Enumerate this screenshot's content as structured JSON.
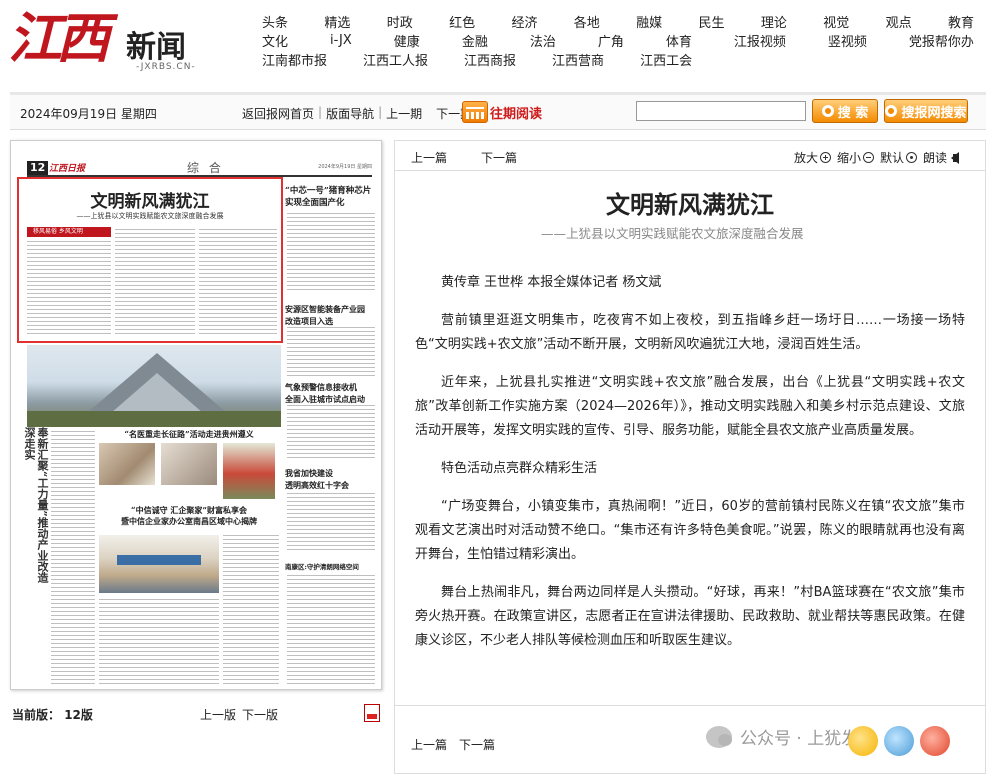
{
  "logo": {
    "script": "江西",
    "name": "新闻",
    "url": "-JXRBS.CN-"
  },
  "nav": {
    "row1": [
      "头条",
      "精选",
      "时政",
      "红色",
      "经济",
      "各地",
      "融媒",
      "民生",
      "理论",
      "视觉",
      "观点",
      "教育"
    ],
    "row2": [
      "文化",
      "i-JX",
      "健康",
      "金融",
      "法治",
      "广角",
      "体育",
      "江报视频",
      "竖视频",
      "党报帮你办"
    ],
    "row3": [
      "江南都市报",
      "江西工人报",
      "江西商报",
      "江西营商",
      "江西工会"
    ]
  },
  "toolbar": {
    "date": "2024年09月19日 星期四",
    "links": [
      "返回报网首页",
      "版面导航",
      "上一期",
      "下一期"
    ],
    "archive": "往期阅读",
    "search_value": "",
    "search_button": "搜 索",
    "site_search_button": "搜报网搜索"
  },
  "page": {
    "number": "12",
    "paper": "江西日报",
    "section": "综 合",
    "date": "2024年9月19日 星期四",
    "article_title": "文明新风满犹江",
    "article_sub": "——上犹县以文明实践赋能农文旅深度融合发展",
    "tag": "移风易俗 乡风文明",
    "side1": "“中芯一号”猪育种芯片\n实现全面国产化",
    "side2": "安源区智能装备产业园\n改造项目入选",
    "side3": "气象预警信息接收机\n全面入驻城市试点启动",
    "side4": "我省加快建设\n透明高效红十字会",
    "side5": "南康区:守护清朗网络空间",
    "vertical": "奉新汇聚“工力量”推动产业改造深走实",
    "mid1": "“名医重走长征路”活动走进贵州遵义",
    "mid2": "“中信诚守 汇企聚家”财富私享会\n暨中信企业家办公室南昌区域中心揭牌",
    "current_label": "当前版：",
    "current_value": "12版",
    "prev": "上一版",
    "next": "下一版"
  },
  "article": {
    "top_prev": "上一篇",
    "top_next": "下一篇",
    "zoom_in": "放大",
    "zoom_out": "缩小",
    "default": "默认",
    "read": "朗读",
    "title": "文明新风满犹江",
    "subtitle": "——上犹县以文明实践赋能农文旅深度融合发展",
    "paragraphs": [
      "黄传章 王世桦 本报全媒体记者 杨文斌",
      "营前镇里逛逛文明集市，吃夜宵不如上夜校，到五指峰乡赶一场圩日……一场接一场特色“文明实践+农文旅”活动不断开展，文明新风吹遍犹江大地，浸润百姓生活。",
      "近年来，上犹县扎实推进“文明实践+农文旅”融合发展，出台《上犹县“文明实践+农文旅”改革创新工作实施方案（2024—2026年）》，推动文明实践融入和美乡村示范点建设、文旅活动开展等，发挥文明实践的宣传、引导、服务功能，赋能全县农文旅产业高质量发展。",
      "特色活动点亮群众精彩生活",
      "“广场变舞台，小镇变集市，真热闹啊！”近日，60岁的营前镇村民陈义在镇“农文旅”集市观看文艺演出时对活动赞不绝口。“集市还有许多特色美食呢。”说罢，陈义的眼睛就再也没有离开舞台，生怕错过精彩演出。",
      "舞台上热闹非凡，舞台两边同样是人头攒动。“好球，再来！”村BA篮球赛在“农文旅”集市旁火热开赛。在政策宣讲区，志愿者正在宣讲法律援助、民政救助、就业帮扶等惠民政策。在健康义诊区，不少老人排队等候检测血压和听取医生建议。"
    ],
    "bottom_prev": "上一篇",
    "bottom_next": "下一篇"
  },
  "watermark": "公众号 · 上犹发布"
}
